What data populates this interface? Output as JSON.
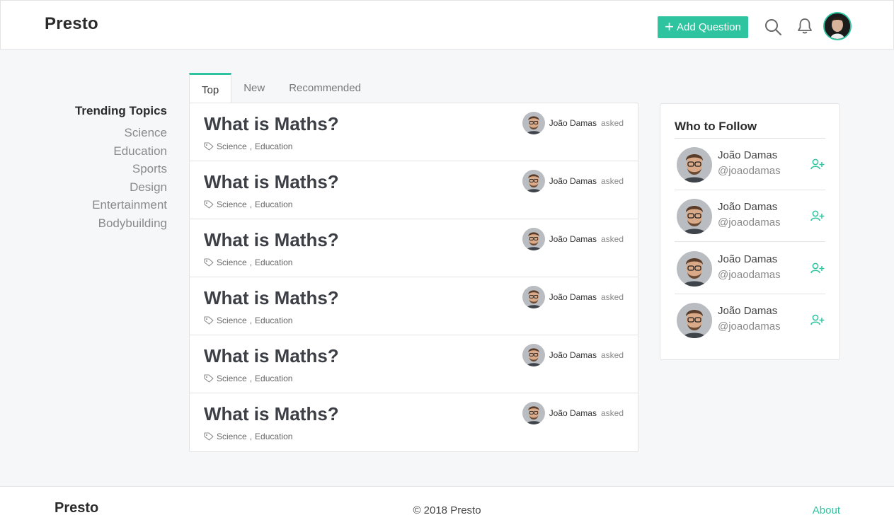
{
  "header": {
    "brand": "Presto",
    "add_question_label": "Add Question",
    "icons": {
      "search": "search-icon",
      "notifications": "bell-icon",
      "profile": "avatar"
    }
  },
  "trending": {
    "title": "Trending Topics",
    "topics": [
      "Science",
      "Education",
      "Sports",
      "Design",
      "Entertainment",
      "Bodybuilding"
    ]
  },
  "tabs": [
    {
      "label": "Top",
      "active": true
    },
    {
      "label": "New",
      "active": false
    },
    {
      "label": "Recommended",
      "active": false
    }
  ],
  "questions": [
    {
      "title": "What is Maths?",
      "asker": "João Damas",
      "verb": "asked",
      "tags": [
        "Science",
        "Education"
      ]
    },
    {
      "title": "What is Maths?",
      "asker": "João Damas",
      "verb": "asked",
      "tags": [
        "Science",
        "Education"
      ]
    },
    {
      "title": "What is Maths?",
      "asker": "João Damas",
      "verb": "asked",
      "tags": [
        "Science",
        "Education"
      ]
    },
    {
      "title": "What is Maths?",
      "asker": "João Damas",
      "verb": "asked",
      "tags": [
        "Science",
        "Education"
      ]
    },
    {
      "title": "What is Maths?",
      "asker": "João Damas",
      "verb": "asked",
      "tags": [
        "Science",
        "Education"
      ]
    },
    {
      "title": "What is Maths?",
      "asker": "João Damas",
      "verb": "asked",
      "tags": [
        "Science",
        "Education"
      ]
    }
  ],
  "who_to_follow": {
    "title": "Who to Follow",
    "users": [
      {
        "name": "João Damas",
        "handle": "@joaodamas"
      },
      {
        "name": "João Damas",
        "handle": "@joaodamas"
      },
      {
        "name": "João Damas",
        "handle": "@joaodamas"
      },
      {
        "name": "João Damas",
        "handle": "@joaodamas"
      }
    ]
  },
  "footer": {
    "brand": "Presto",
    "copyright": "© 2018 Presto",
    "about": "About"
  },
  "colors": {
    "accent": "#2ec4a0",
    "background": "#f6f7f9",
    "border": "#e3e3e3"
  }
}
